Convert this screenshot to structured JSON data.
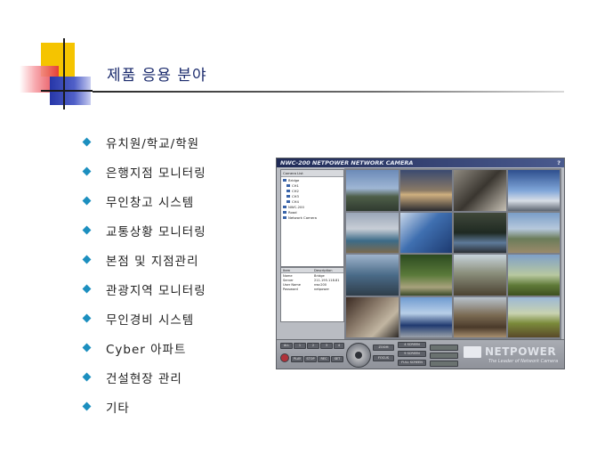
{
  "slide": {
    "title": "제품 응용 분야",
    "bullets": [
      "유치원/학교/학원",
      "은행지점 모니터링",
      "무인창고 시스템",
      "교통상황 모니터링",
      "본점 및 지점관리",
      "관광지역 모니터링",
      "무인경비 시스템",
      "Cyber 아파트",
      "건설현장 관리",
      "기타"
    ],
    "accent_colors": {
      "title": "#1a2a6c",
      "bullet": "#1c8fbf",
      "yellow": "#f5c400",
      "red": "#e2323c",
      "blue": "#2636a8"
    }
  },
  "app": {
    "window_title": "NWC-200  NETPOWER NETWORK CAMERA",
    "help_label": "?",
    "tree": {
      "header": "Camera List",
      "items": [
        "Bridge",
        "CH1",
        "CH2",
        "CH3",
        "CH4",
        "NWC-200",
        "Road",
        "Network Camera"
      ]
    },
    "info": {
      "columns": [
        "Item",
        "Description"
      ],
      "rows": [
        [
          "Name",
          "Bridge"
        ],
        [
          "Server",
          "211.195.118.81"
        ],
        [
          "User Name",
          "nwc200"
        ],
        [
          "Password",
          "netpower"
        ]
      ]
    },
    "controls": {
      "left_buttons": [
        "ALL",
        "1",
        "2",
        "3",
        "4"
      ],
      "record_labels": [
        "PLAY",
        "STOP",
        "REC",
        "SET"
      ],
      "zoom_labels": [
        "ZOOM",
        "FOCUS"
      ],
      "screen_labels": [
        "4 SCREEN",
        "9 SCREEN",
        "FULL SCREEN"
      ]
    },
    "brand": {
      "name": "NETPOWER",
      "tagline": "The Leader of Network Camera"
    }
  }
}
